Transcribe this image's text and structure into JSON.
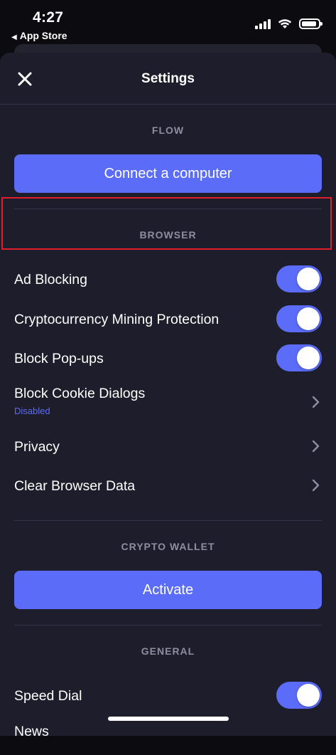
{
  "status_bar": {
    "time": "4:27",
    "back_app": "App Store"
  },
  "header": {
    "title": "Settings",
    "close_icon": "close-icon"
  },
  "sections": {
    "flow": {
      "label": "FLOW",
      "button": "Connect a computer"
    },
    "browser": {
      "label": "BROWSER",
      "items": [
        {
          "label": "Ad Blocking",
          "type": "toggle",
          "on": true
        },
        {
          "label": "Cryptocurrency Mining Protection",
          "type": "toggle",
          "on": true
        },
        {
          "label": "Block Pop-ups",
          "type": "toggle",
          "on": true
        },
        {
          "label": "Block Cookie Dialogs",
          "sublabel": "Disabled",
          "type": "chevron"
        },
        {
          "label": "Privacy",
          "type": "chevron"
        },
        {
          "label": "Clear Browser Data",
          "type": "chevron"
        }
      ]
    },
    "crypto_wallet": {
      "label": "CRYPTO WALLET",
      "button": "Activate"
    },
    "general": {
      "label": "GENERAL",
      "items": [
        {
          "label": "Speed Dial",
          "type": "toggle",
          "on": true
        },
        {
          "label": "News",
          "type": "toggle"
        }
      ]
    }
  },
  "colors": {
    "accent": "#5b6df8",
    "background": "#1e1d2b",
    "highlight": "#e01f2d"
  }
}
